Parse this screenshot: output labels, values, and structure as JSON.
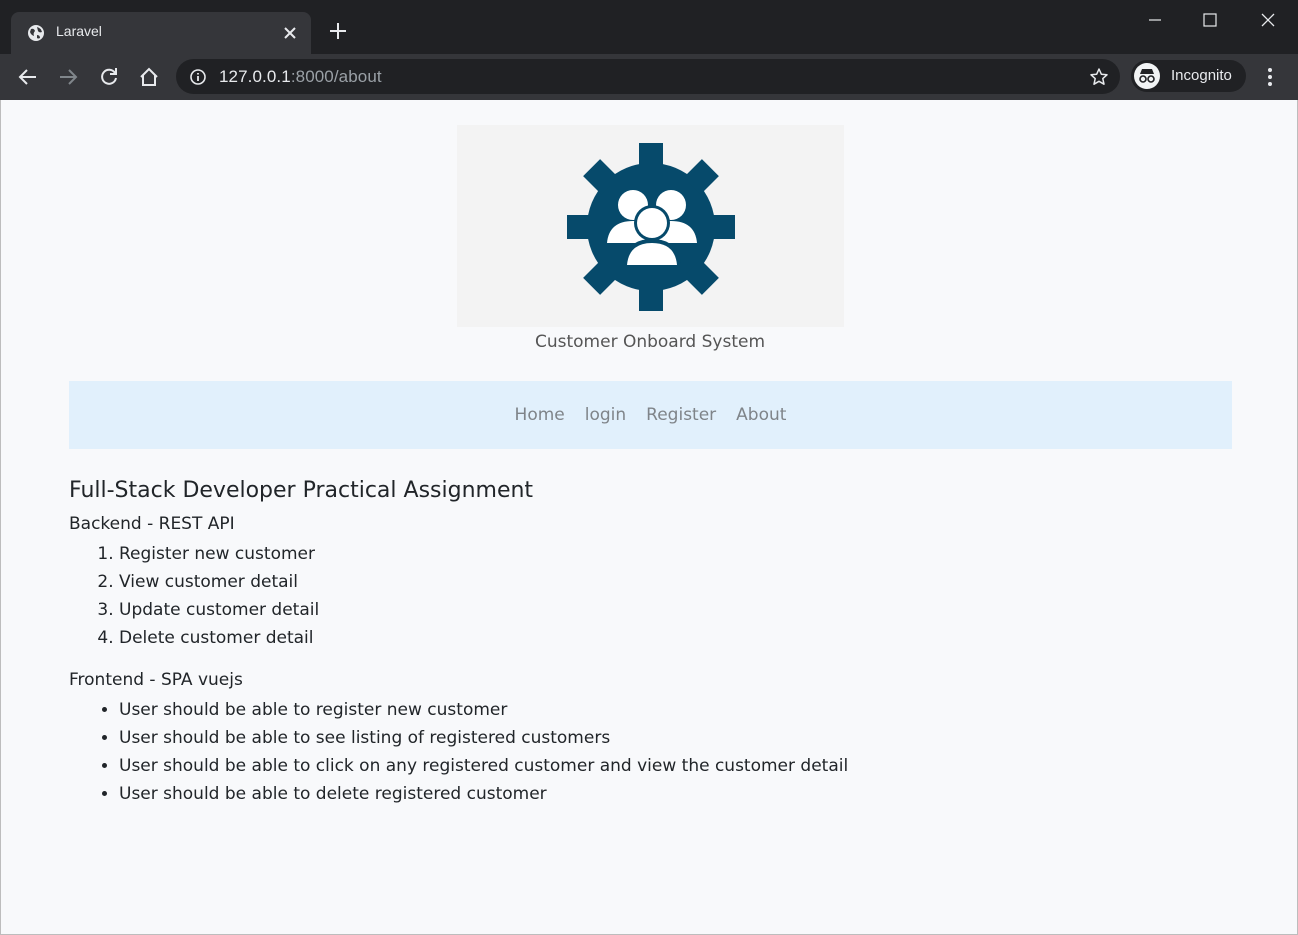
{
  "browser": {
    "tab_title": "Laravel",
    "url_host": "127.0.0.1",
    "url_path": ":8000/about",
    "profile_label": "Incognito"
  },
  "header": {
    "site_name": "Customer Onboard System",
    "logo_color": "#064a6b"
  },
  "nav": {
    "links": [
      "Home",
      "login",
      "Register",
      "About"
    ]
  },
  "main": {
    "title": "Full-Stack Developer Practical Assignment",
    "backend": {
      "heading": "Backend - REST API",
      "items": [
        "Register new customer",
        "View customer detail",
        "Update customer detail",
        "Delete customer detail"
      ]
    },
    "frontend": {
      "heading": "Frontend - SPA vuejs",
      "items": [
        "User should be able to register new customer",
        "User should be able to see listing of registered customers",
        "User should be able to click on any registered customer and view the customer detail",
        "User should be able to delete registered customer"
      ]
    }
  }
}
